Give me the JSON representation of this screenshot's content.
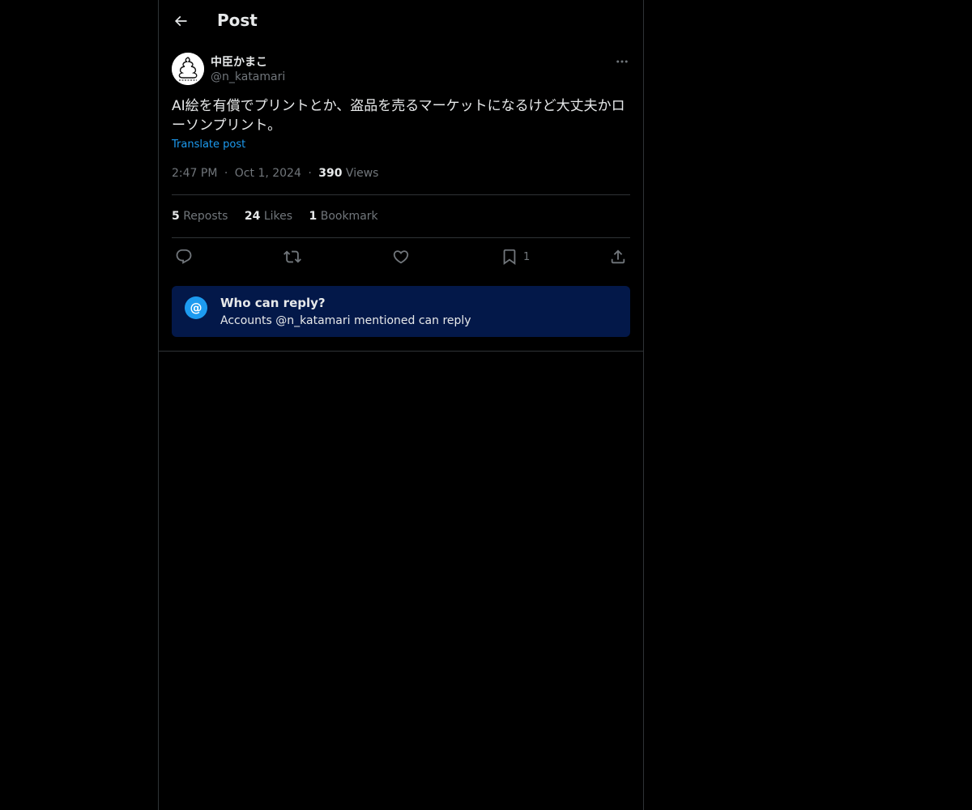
{
  "header": {
    "title": "Post",
    "back_icon": "arrow-left-icon"
  },
  "post": {
    "author": {
      "name": "中臣かまこ",
      "handle": "@n_katamari",
      "avatar_icon": "avatar-image"
    },
    "more_icon": "more-dots-icon",
    "text": "AI絵を有償でプリントとか、盗品を売るマーケットになるけど大丈夫かローソンプリント。",
    "translate_label": "Translate post",
    "time": "2:47 PM",
    "date": "Oct 1, 2024",
    "views_count": "390",
    "views_label": "Views",
    "separator": "·"
  },
  "stats": {
    "reposts_count": "5",
    "reposts_label": "Reposts",
    "likes_count": "24",
    "likes_label": "Likes",
    "bookmarks_count": "1",
    "bookmarks_label": "Bookmark"
  },
  "actions": {
    "reply_icon": "reply-icon",
    "repost_icon": "repost-icon",
    "like_icon": "heart-icon",
    "bookmark_icon": "bookmark-icon",
    "bookmark_count": "1",
    "share_icon": "share-icon"
  },
  "reply_restriction": {
    "icon_glyph": "@",
    "title": "Who can reply?",
    "subtitle": "Accounts @n_katamari mentioned can reply"
  },
  "colors": {
    "background": "#000000",
    "text": "#e7e9ea",
    "muted": "#71767b",
    "accent": "#1d9bf0",
    "border": "#2f3336",
    "reply_box": "#031849"
  }
}
